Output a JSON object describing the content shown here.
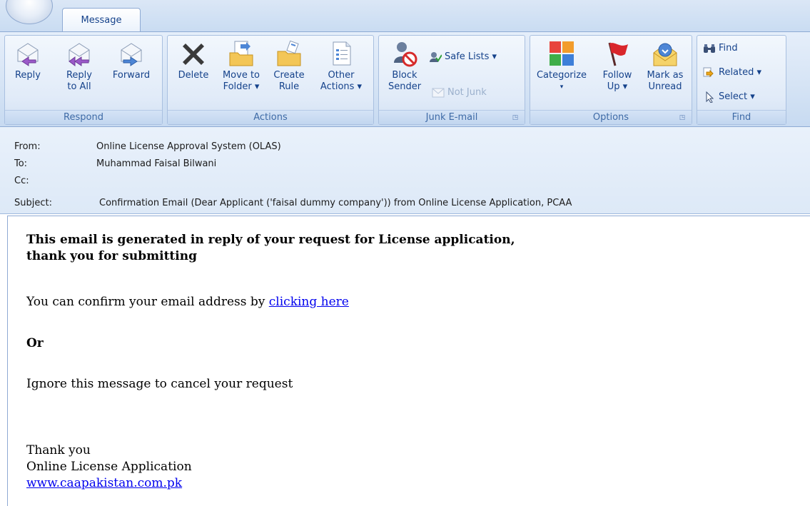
{
  "tabs": {
    "message": "Message"
  },
  "ribbon": {
    "respond": {
      "label": "Respond",
      "reply": "Reply",
      "reply_all_1": "Reply",
      "reply_all_2": "to All",
      "forward": "Forward"
    },
    "actions": {
      "label": "Actions",
      "delete": "Delete",
      "move_1": "Move to",
      "move_2": "Folder ▾",
      "create_1": "Create",
      "create_2": "Rule",
      "other_1": "Other",
      "other_2": "Actions ▾"
    },
    "junk": {
      "label": "Junk E-mail",
      "block_1": "Block",
      "block_2": "Sender",
      "safe_lists": "Safe Lists ▾",
      "not_junk": "Not Junk"
    },
    "options": {
      "label": "Options",
      "categorize": "Categorize",
      "categorize_arrow": "▾",
      "follow_1": "Follow",
      "follow_2": "Up ▾",
      "mark_1": "Mark as",
      "mark_2": "Unread"
    },
    "find": {
      "label": "Find",
      "find": "Find",
      "related": "Related ▾",
      "select": "Select ▾"
    }
  },
  "header": {
    "from_label": "From:",
    "from_value": "Online License Approval System (OLAS)",
    "to_label": "To:",
    "to_value": "Muhammad Faisal Bilwani",
    "cc_label": "Cc:",
    "cc_value": "",
    "subject_label": "Subject:",
    "subject_value": "Confirmation Email (Dear Applicant ('faisal dummy company')) from Online License Application, PCAA"
  },
  "body": {
    "heading_1": "This email is generated in reply of your request for License application,",
    "heading_2": "thank you for submitting",
    "confirm_text": "You can confirm your email address by ",
    "confirm_link": "clicking here",
    "or": "Or",
    "ignore": "Ignore this message to cancel your request",
    "thanks": "Thank you",
    "signature": "Online License Application",
    "website": "www.caapakistan.com.pk"
  },
  "colors": {
    "ribbon_text": "#15428b",
    "link": "#0000ee",
    "ribbon_bg": "#d6e4f5"
  }
}
